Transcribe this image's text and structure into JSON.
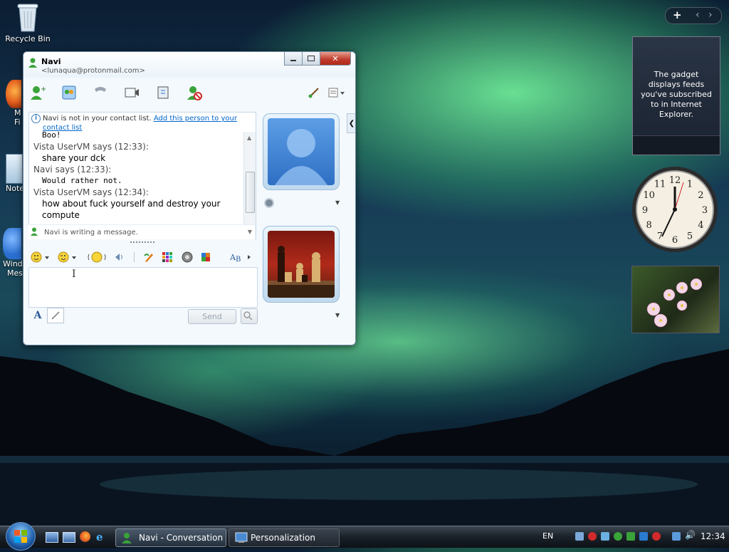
{
  "desktop": {
    "recycle_bin_label": "Recycle Bin",
    "partial_icons": [
      {
        "name": "firefox-shortcut",
        "label_lines": [
          "M",
          "Fi"
        ]
      },
      {
        "name": "notepad-shortcut",
        "label_lines": [
          "Note"
        ]
      },
      {
        "name": "windows-messenger-shortcut",
        "label_lines": [
          "Wind",
          "Mes"
        ]
      }
    ]
  },
  "sidebar": {
    "add_gadget": "+",
    "prev": "‹",
    "next": "›",
    "feed_gadget_text": "The gadget displays feeds you've subscribed to in Internet Explorer.",
    "clock_numbers": [
      "12",
      "1",
      "2",
      "3",
      "4",
      "5",
      "6",
      "7",
      "8",
      "9",
      "10",
      "11"
    ]
  },
  "conversation": {
    "contact_name": "Navi",
    "contact_email": "<lunaqua@protonmail.com>",
    "notice_text": "Navi is not in your contact list.",
    "notice_link": "Add this person to your contact list",
    "messages": [
      {
        "type": "text",
        "text": "Boo!",
        "mono": true
      },
      {
        "type": "header",
        "text": "Vista UserVM says (12:33):"
      },
      {
        "type": "text",
        "text": "share your dck",
        "mono": false
      },
      {
        "type": "header",
        "text": "Navi says (12:33):"
      },
      {
        "type": "text",
        "text": "Would rather not.",
        "mono": true
      },
      {
        "type": "header",
        "text": "Vista UserVM says (12:34):"
      },
      {
        "type": "text",
        "text": "how about fuck yourself and destroy your",
        "mono": false
      },
      {
        "type": "text",
        "text": "compute",
        "mono": false
      }
    ],
    "typing_status": "Navi is writing a message.",
    "send_label": "Send",
    "input_value": ""
  },
  "taskbar": {
    "tasks": [
      {
        "label": "Navi - Conversation",
        "active": true
      },
      {
        "label": "Personalization",
        "active": false
      }
    ],
    "language": "EN",
    "clock": "12:34"
  },
  "colors": {
    "accent": "#0066cc",
    "window_bg": "#f4f9fd",
    "taskbar_active": "#4b5a6b"
  }
}
